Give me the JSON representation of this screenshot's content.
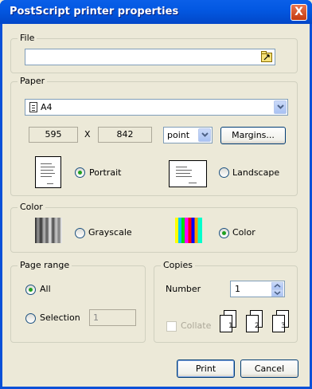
{
  "window": {
    "title": "PostScript printer properties",
    "close_label": "X"
  },
  "file": {
    "group_label": "File",
    "path_value": ""
  },
  "paper": {
    "group_label": "Paper",
    "size_selected": "A4",
    "width_value": "595",
    "x_label": "X",
    "height_value": "842",
    "unit_selected": "point",
    "margins_label": "Margins...",
    "portrait_label": "Portrait",
    "landscape_label": "Landscape",
    "orientation_selected": "Portrait"
  },
  "color": {
    "group_label": "Color",
    "grayscale_label": "Grayscale",
    "color_label": "Color",
    "selected": "Color"
  },
  "page_range": {
    "group_label": "Page range",
    "all_label": "All",
    "selection_label": "Selection",
    "selection_value": "1",
    "selected": "All"
  },
  "copies": {
    "group_label": "Copies",
    "number_label": "Number",
    "number_value": "1",
    "collate_label": "Collate",
    "collate_checked": false,
    "collate_enabled": false
  },
  "buttons": {
    "print_label": "Print",
    "cancel_label": "Cancel"
  },
  "colors": {
    "title_bar": "#0358e2",
    "dialog_bg": "#ece9d8",
    "radio_dot": "#21a121",
    "close_button": "#c43a10"
  }
}
